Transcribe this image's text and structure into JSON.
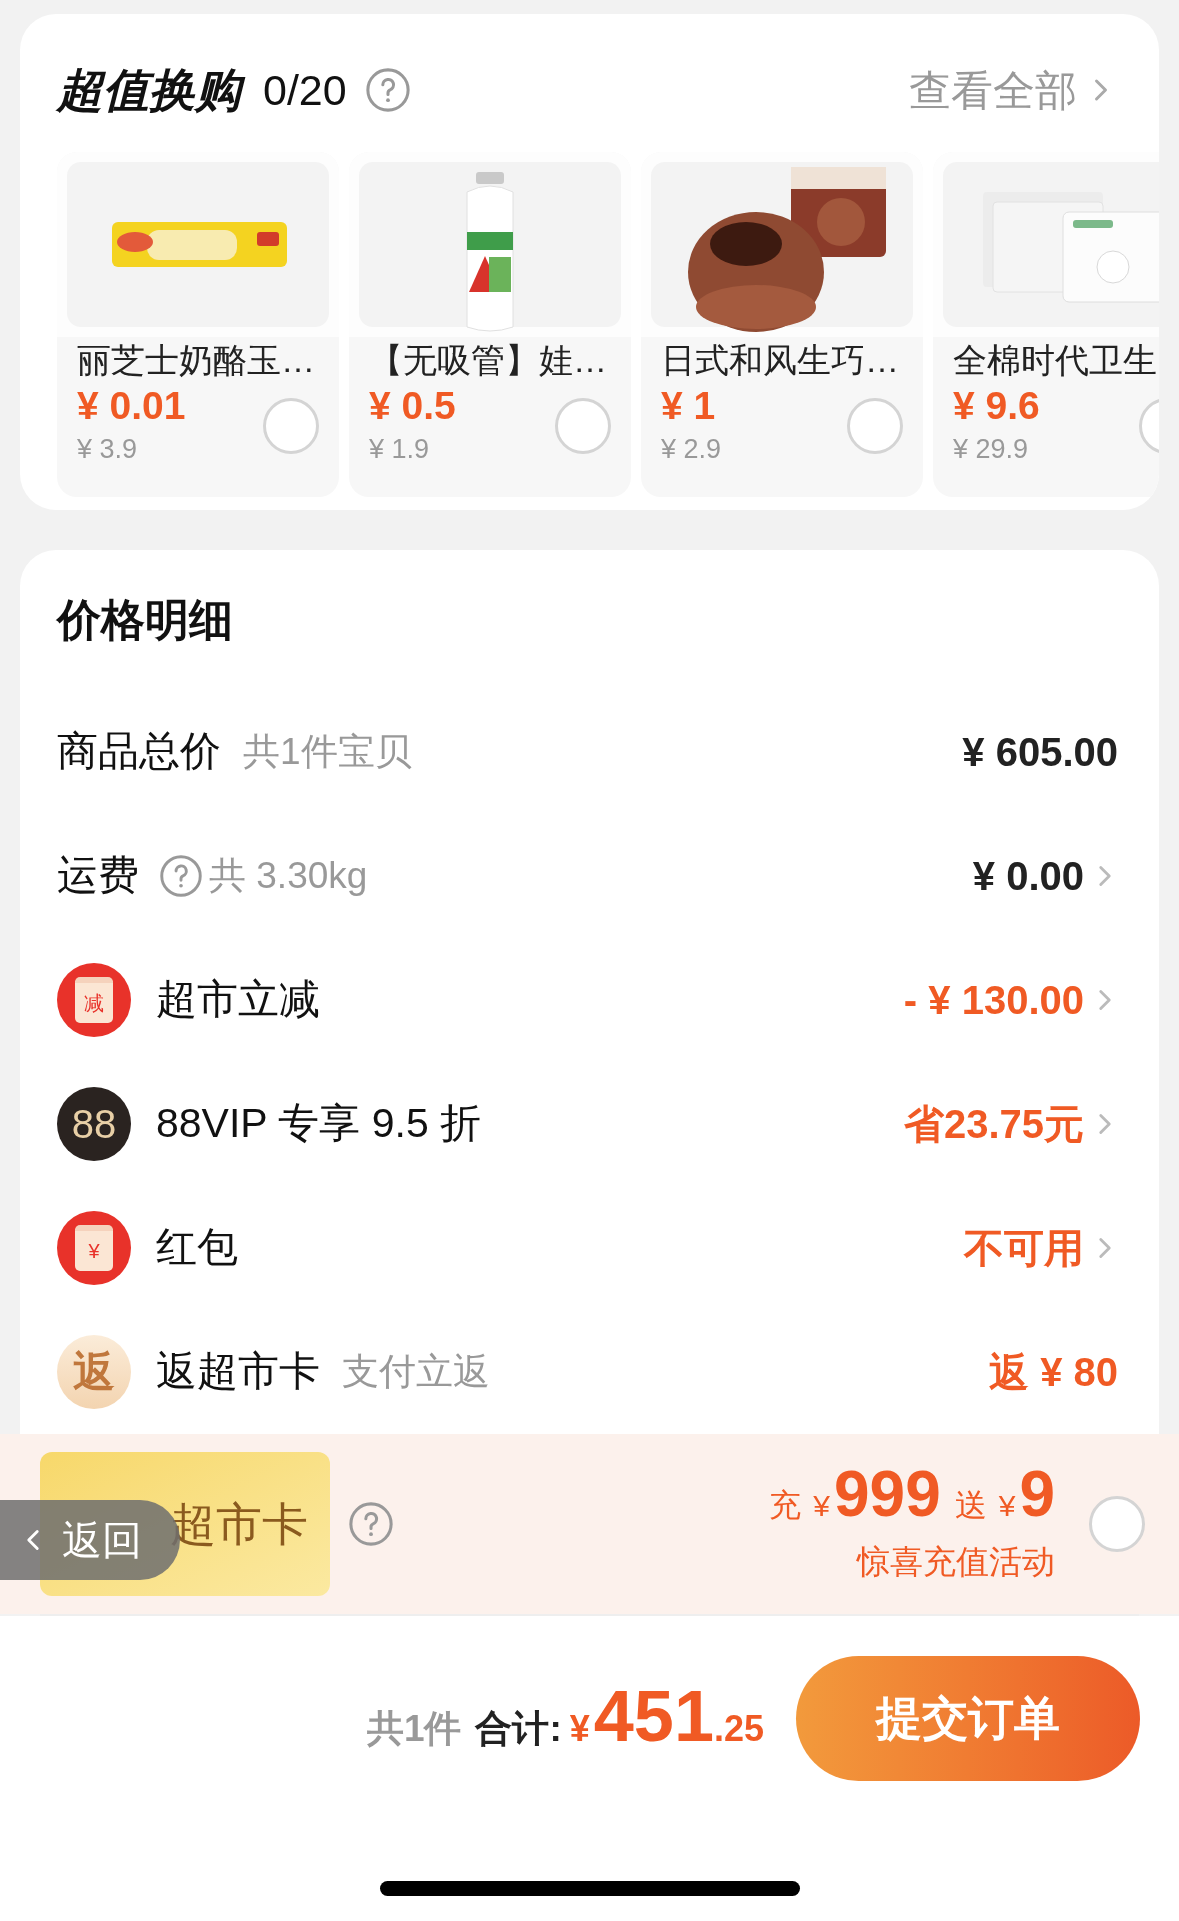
{
  "exchange": {
    "title": "超值换购",
    "count": "0/20",
    "view_all": "查看全部",
    "items": [
      {
        "name": "丽芝士奶酪玉…",
        "price": "¥ 0.01",
        "original_price": "¥ 3.9",
        "selected": false
      },
      {
        "name": "【无吸管】娃…",
        "price": "¥ 0.5",
        "original_price": "¥ 1.9",
        "selected": false
      },
      {
        "name": "日式和风生巧…",
        "price": "¥ 1",
        "original_price": "¥ 2.9",
        "selected": false
      },
      {
        "name": "全棉时代卫生",
        "price": "¥ 9.6",
        "original_price": "¥ 29.9",
        "selected": false
      }
    ]
  },
  "price_detail": {
    "title": "价格明细",
    "rows": [
      {
        "kind": "plain",
        "label": "商品总价",
        "note": "共1件宝贝",
        "value": "¥ 605.00",
        "highlight": false,
        "arrow": false
      },
      {
        "kind": "help",
        "label": "运费",
        "note": "共 3.30kg",
        "value": "¥ 0.00",
        "highlight": false,
        "arrow": true
      },
      {
        "kind": "reduce",
        "icon_text": "减",
        "label": "超市立减",
        "value": "- ¥ 130.00",
        "highlight": true,
        "arrow": true
      },
      {
        "kind": "vip",
        "icon_text": "88",
        "label": "88VIP 专享 9.5 折",
        "value": "省23.75元",
        "highlight": true,
        "arrow": true
      },
      {
        "kind": "redpacket",
        "icon_text": "¥",
        "label": "红包",
        "value": "不可用",
        "highlight": true,
        "arrow": true
      },
      {
        "kind": "rebate",
        "icon_text": "返",
        "label": "返超市卡",
        "note": "支付立返",
        "value": "返 ¥ 80",
        "highlight": true,
        "arrow": false
      }
    ]
  },
  "recharge": {
    "card_label": "超市卡",
    "prefix": "充",
    "currency": "¥",
    "amount": "999",
    "bonus_label": "送",
    "bonus_currency": "¥",
    "bonus": "9",
    "subtitle": "惊喜充值活动",
    "selected": false
  },
  "back_button": {
    "label": "返回"
  },
  "footer": {
    "count": "共1件",
    "total_label": "合计:",
    "currency": "¥",
    "total_int": "451",
    "total_dec": ".25",
    "submit": "提交订单"
  }
}
